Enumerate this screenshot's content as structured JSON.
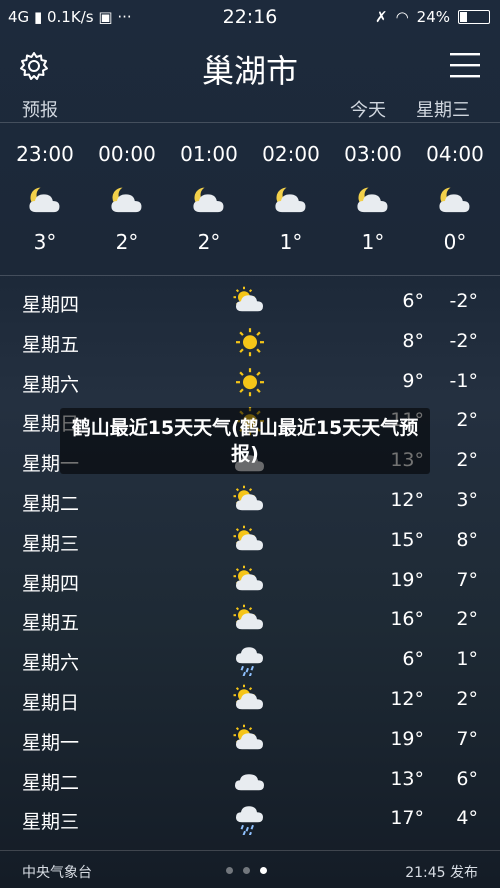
{
  "status_bar": {
    "network": "4G",
    "speed": "0.1K/s",
    "menu": "···",
    "time": "22:16",
    "battery": "24%",
    "battery_level": 0.24
  },
  "header": {
    "title": "巢湖市"
  },
  "subbar": {
    "label": "预报",
    "today": "今天",
    "weekday": "星期三"
  },
  "hourly": [
    {
      "time": "23:00",
      "icon": "night-partly-cloudy-icon",
      "temp": "3°"
    },
    {
      "time": "00:00",
      "icon": "night-partly-cloudy-icon",
      "temp": "2°"
    },
    {
      "time": "01:00",
      "icon": "night-partly-cloudy-icon",
      "temp": "2°"
    },
    {
      "time": "02:00",
      "icon": "night-partly-cloudy-icon",
      "temp": "1°"
    },
    {
      "time": "03:00",
      "icon": "night-partly-cloudy-icon",
      "temp": "1°"
    },
    {
      "time": "04:00",
      "icon": "night-partly-cloudy-icon",
      "temp": "0°"
    }
  ],
  "daily": [
    {
      "day": "星期四",
      "icon": "partly-cloudy-icon",
      "hi": "6°",
      "lo": "-2°"
    },
    {
      "day": "星期五",
      "icon": "sunny-icon",
      "hi": "8°",
      "lo": "-2°"
    },
    {
      "day": "星期六",
      "icon": "sunny-icon",
      "hi": "9°",
      "lo": "-1°"
    },
    {
      "day": "星期日",
      "icon": "sunny-icon",
      "hi": "11°",
      "lo": "2°"
    },
    {
      "day": "星期一",
      "icon": "cloudy-icon",
      "hi": "13°",
      "lo": "2°"
    },
    {
      "day": "星期二",
      "icon": "partly-cloudy-icon",
      "hi": "12°",
      "lo": "3°"
    },
    {
      "day": "星期三",
      "icon": "partly-cloudy-icon",
      "hi": "15°",
      "lo": "8°"
    },
    {
      "day": "星期四",
      "icon": "partly-cloudy-icon",
      "hi": "19°",
      "lo": "7°"
    },
    {
      "day": "星期五",
      "icon": "partly-cloudy-icon",
      "hi": "16°",
      "lo": "2°"
    },
    {
      "day": "星期六",
      "icon": "rain-icon",
      "hi": "6°",
      "lo": "1°"
    },
    {
      "day": "星期日",
      "icon": "partly-cloudy-icon",
      "hi": "12°",
      "lo": "2°"
    },
    {
      "day": "星期一",
      "icon": "partly-cloudy-icon",
      "hi": "19°",
      "lo": "7°"
    },
    {
      "day": "星期二",
      "icon": "cloudy-icon",
      "hi": "13°",
      "lo": "6°"
    },
    {
      "day": "星期三",
      "icon": "rain-icon",
      "hi": "17°",
      "lo": "4°"
    }
  ],
  "overlay": {
    "text": "鹤山最近15天天气(鹤山最近15天天气预报)"
  },
  "footer": {
    "source": "中央气象台",
    "published": "21:45 发布",
    "page_count": 3,
    "active_page": 3
  },
  "colors": {
    "sun": "#f5c518",
    "cloud": "#e8ecf0",
    "moon": "#f2d04a"
  }
}
